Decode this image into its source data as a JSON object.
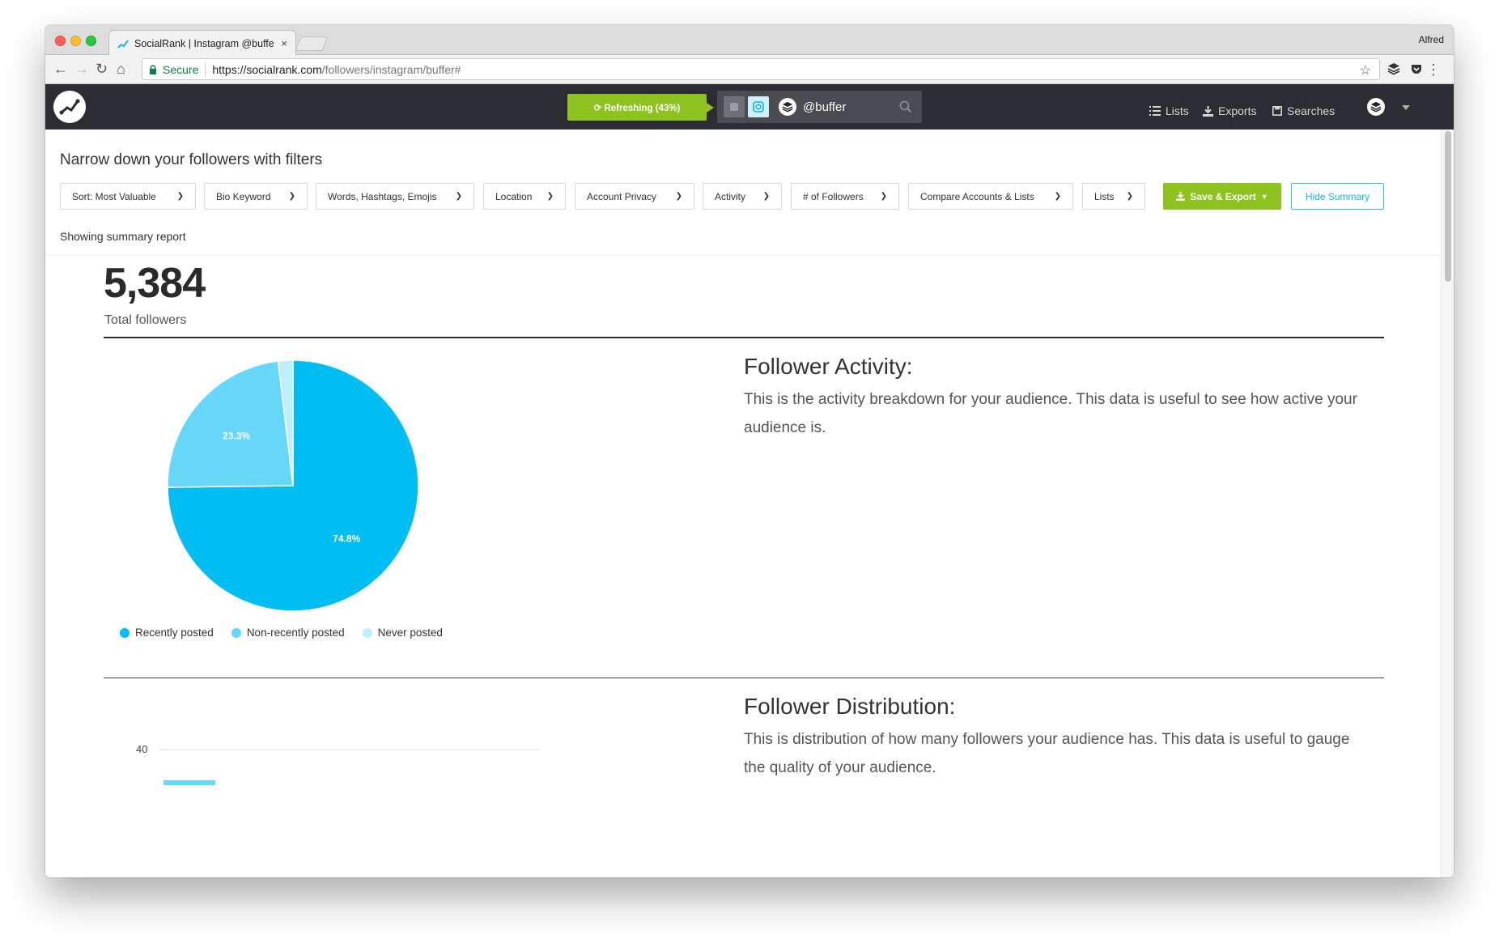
{
  "browser": {
    "tab_title": "SocialRank | Instagram @buffe",
    "tab_close": "×",
    "profile_name": "Alfred",
    "secure_label": "Secure",
    "url_scheme_host": "https://socialrank.com",
    "url_path": "/followers/instagram/buffer#"
  },
  "header": {
    "refresh_label": "⟳ Refreshing (43%)",
    "account_handle": "@buffer",
    "nav": {
      "lists": "Lists",
      "exports": "Exports",
      "searches": "Searches"
    }
  },
  "filters": {
    "title": "Narrow down your followers with filters",
    "buttons": [
      "Sort: Most Valuable",
      "Bio Keyword",
      "Words, Hashtags, Emojis",
      "Location",
      "Account Privacy",
      "Activity",
      "# of Followers",
      "Compare Accounts & Lists",
      "Lists"
    ],
    "save_export": "Save & Export",
    "hide_summary": "Hide Summary",
    "summary_note": "Showing summary report"
  },
  "summary": {
    "total": "5,384",
    "total_label": "Total followers"
  },
  "activity": {
    "title": "Follower Activity:",
    "description": "This is the activity breakdown for your audience. This data is useful to see how active your audience is."
  },
  "distribution": {
    "title": "Follower Distribution:",
    "description": "This is distribution of how many followers your audience has. This data is useful to gauge the quality of your audience.",
    "axis_tick": "40"
  },
  "chart_data": {
    "type": "pie",
    "title": "",
    "categories": [
      "Recently posted",
      "Non-recently posted",
      "Never posted"
    ],
    "values": [
      74.8,
      23.3,
      1.9
    ],
    "data_labels": [
      "74.8%",
      "23.3%",
      ""
    ],
    "colors": [
      "#00bdf2",
      "#66d7f7",
      "#bdeefc"
    ],
    "legend": "bottom"
  },
  "colors": {
    "accent_green": "#8dc21f",
    "accent_blue": "#1ab4e8",
    "header_bg": "#2b2d33"
  }
}
